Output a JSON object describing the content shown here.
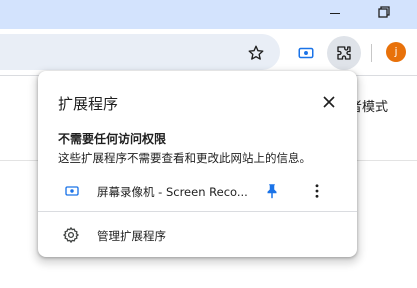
{
  "window": {
    "colors": {
      "titlebar": "#d3e3fd",
      "accent": "#1a73e8",
      "avatar": "#e8710a"
    }
  },
  "toolbar": {
    "avatar_letter": "j"
  },
  "background": {
    "partial_text": "者模式"
  },
  "popup": {
    "title": "扩展程序",
    "section_heading": "不需要任何访问权限",
    "section_desc": "这些扩展程序不需要查看和更改此网站上的信息。",
    "extension": {
      "name": "屏幕录像机 - Screen Reco...",
      "icon": "screen-recorder-icon",
      "pinned": true
    },
    "manage_label": "管理扩展程序"
  }
}
